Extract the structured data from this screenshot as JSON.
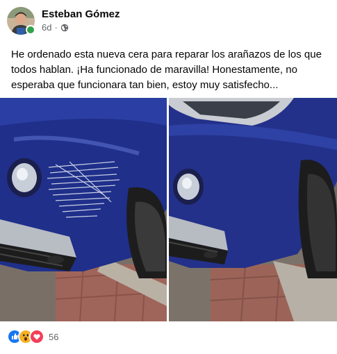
{
  "post": {
    "author": "Esteban Gómez",
    "time": "6d",
    "separator": "·",
    "privacy_icon": "globe-icon",
    "text": "He ordenado esta nueva cera para reparar los arañazos de los que todos hablan. ¡Ha funcionado de maravilla! Honestamente, no esperaba que funcionara tan bien, estoy muy satisfecho...",
    "photos": [
      {
        "name": "before-photo",
        "description_icon": "scratched-car-bumper"
      },
      {
        "name": "after-photo",
        "description_icon": "repaired-car-bumper"
      }
    ]
  },
  "reactions": {
    "icons": [
      "like-icon",
      "wow-icon",
      "love-icon"
    ],
    "count": "56"
  },
  "colors": {
    "online": "#31a24c",
    "like": "#1877f2",
    "love": "#f33e58",
    "wow": "#f7b125",
    "car_blue": "#1f2f8a"
  }
}
